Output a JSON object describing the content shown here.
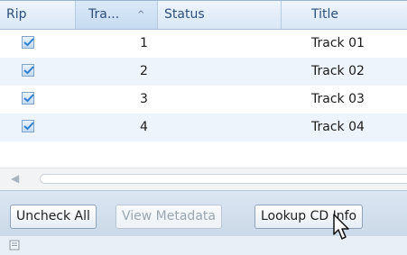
{
  "grid": {
    "headers": {
      "rip": "Rip",
      "track": "Tra...",
      "status": "Status",
      "title": "Title"
    },
    "sort_icon": "chevron-up-icon",
    "rows": [
      {
        "checked": true,
        "track": "1",
        "status": "",
        "title": "Track 01"
      },
      {
        "checked": true,
        "track": "2",
        "status": "",
        "title": "Track 02"
      },
      {
        "checked": true,
        "track": "3",
        "status": "",
        "title": "Track 03"
      },
      {
        "checked": true,
        "track": "4",
        "status": "",
        "title": "Track 04"
      }
    ]
  },
  "toolbar": {
    "uncheck_all": "Uncheck All",
    "view_metadata": "View Metadata",
    "lookup_cd_info": "Lookup CD Info"
  },
  "colors": {
    "header_text": "#2d4f7c",
    "row_alt": "#eef4fb",
    "check": "#2f7fd0"
  }
}
